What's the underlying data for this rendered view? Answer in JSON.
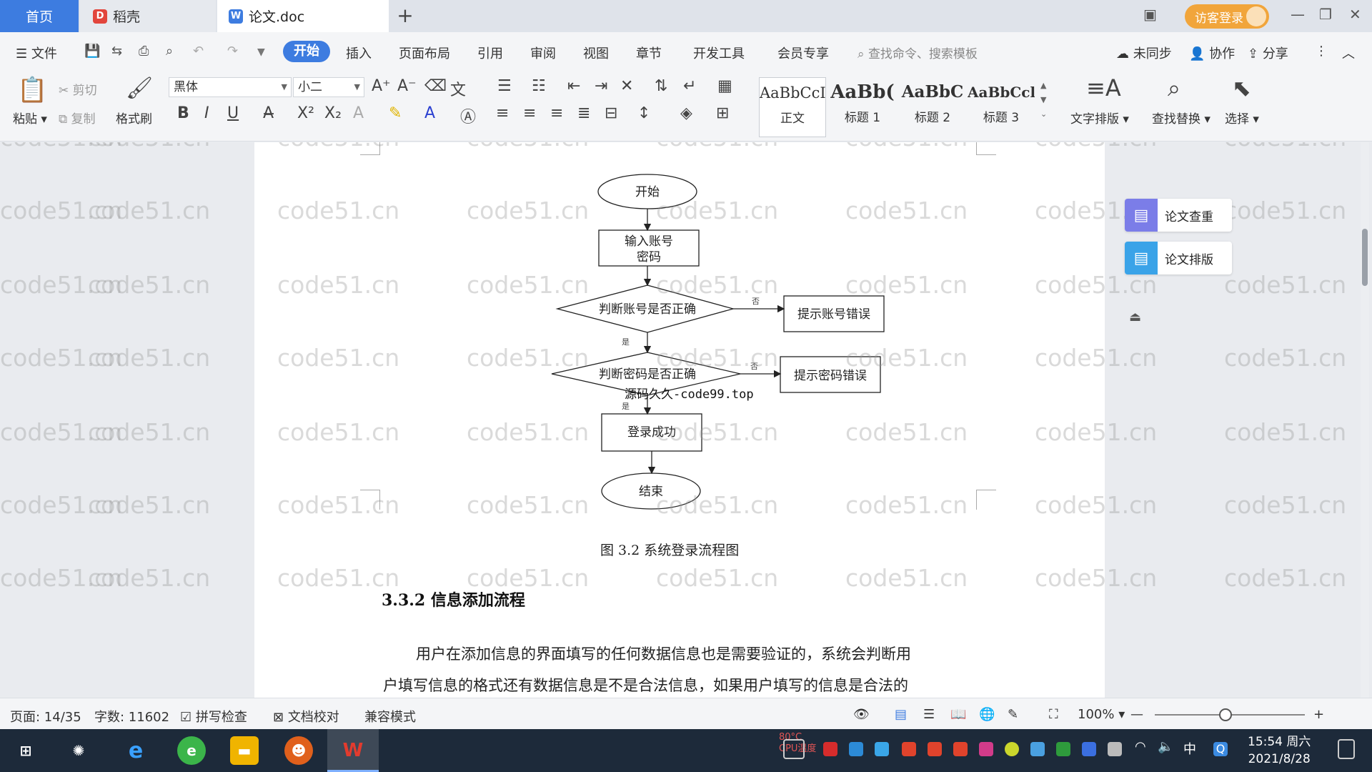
{
  "tabs": {
    "home": "首页",
    "daoke": "稻壳",
    "doc": "论文.doc"
  },
  "header": {
    "login": "访客登录"
  },
  "menu": {
    "file": "文件",
    "items": [
      "开始",
      "插入",
      "页面布局",
      "引用",
      "审阅",
      "视图",
      "章节",
      "开发工具",
      "会员专享"
    ],
    "search_placeholder": "查找命令、搜索模板",
    "sync": "未同步",
    "collab": "协作",
    "share": "分享"
  },
  "ribbon": {
    "paste": "粘贴",
    "cut": "剪切",
    "copy": "复制",
    "format_painter": "格式刷",
    "font_name": "黑体",
    "font_size": "小二",
    "styles": [
      {
        "sample": "AaBbCcI",
        "name": "正文"
      },
      {
        "sample": "AaBb(",
        "name": "标题 1"
      },
      {
        "sample": "AaBbC",
        "name": "标题 2"
      },
      {
        "sample": "AaBbCcl",
        "name": "标题 3"
      }
    ],
    "text_layout": "文字排版",
    "find_replace": "查找替换",
    "select": "选择"
  },
  "flowchart": {
    "start": "开始",
    "input_line1": "输入账号",
    "input_line2": "密码",
    "check_account": "判断账号是否正确",
    "account_error": "提示账号错误",
    "check_password": "判断密码是否正确",
    "password_error": "提示密码错误",
    "success": "登录成功",
    "end": "结束",
    "no": "否",
    "yes": "是",
    "overlay": "源码久久-code99.top"
  },
  "document": {
    "figure_caption": "图 3.2    系统登录流程图",
    "section_title": "3.3.2 信息添加流程",
    "para_line1": "用户在添加信息的界面填写的任何数据信息也是需要验证的，系统会判断用",
    "para_line2": "户填写信息的格式还有数据信息是不是合法信息，如果用户填写的信息是合法的",
    "watermark": "code51.cn"
  },
  "side_panel": {
    "check": "论文查重",
    "layout": "论文排版"
  },
  "status": {
    "page": "页面: 14/35",
    "words": "字数: 11602",
    "spell": "拼写检查",
    "proof": "文档校对",
    "compat": "兼容模式",
    "zoom": "100%"
  },
  "taskbar": {
    "cpu_temp": "80°C",
    "cpu_label": "CPU温度",
    "ime": "中",
    "time": "15:54 周六",
    "date": "2021/8/28"
  },
  "colors": {
    "accent": "#3d7ce0",
    "login": "#f1a53b",
    "taskbar": "#1d2a3a"
  }
}
